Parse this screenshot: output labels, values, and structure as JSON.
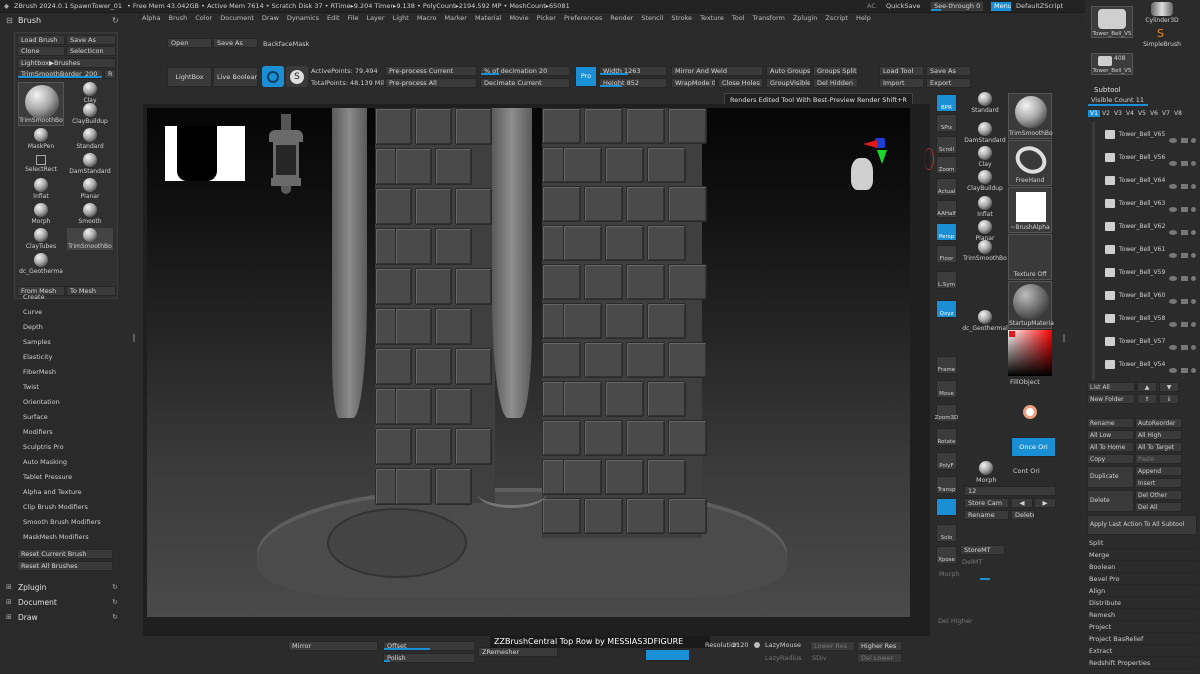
{
  "topbar": {
    "app_title": "ZBrush 2024.0.1",
    "doc_name": "SpawnTower_01",
    "stats": "• Free Mem 43.042GB • Active Mem 7614 • Scratch Disk 37 • RTime▸9.204 Timer▸9.138 • PolyCount▸2194.592 MP • MeshCount▸65081",
    "ac": "AC",
    "quicksave": "QuickSave",
    "seethrough": "See-through",
    "seethrough_val": "0",
    "menus": "Menus",
    "default_zscript": "DefaultZScript"
  },
  "menubar": [
    "Alpha",
    "Brush",
    "Color",
    "Document",
    "Draw",
    "Dynamics",
    "Edit",
    "File",
    "Layer",
    "Light",
    "Macro",
    "Marker",
    "Material",
    "Movie",
    "Picker",
    "Preferences",
    "Render",
    "Stencil",
    "Stroke",
    "Texture",
    "Tool",
    "Transform",
    "Zplugin",
    "Zscript",
    "Help"
  ],
  "brush_panel": {
    "title": "Brush",
    "load_brush": "Load Brush",
    "save_as": "Save As",
    "clone": "Clone",
    "select_icon": "SelectIcon",
    "lightbox_brushes": "Lightbox▶Brushes",
    "current_brush_slider": "TrimSmoothBorder_200",
    "r_btn": "R",
    "current_brush_label": "TrimSmoothBo",
    "brushes": [
      "Clay",
      "ClayBuildup",
      "MaskPen",
      "Standard",
      "SelectRect",
      "DamStandard",
      "Inflat",
      "Planar",
      "Morph",
      "Smooth",
      "ClayTubes",
      "TrimSmoothBo",
      "dc_Geotherma"
    ],
    "from_mesh": "From Mesh",
    "to_mesh": "To Mesh",
    "submenus": [
      "Create",
      "Curve",
      "Depth",
      "Samples",
      "Elasticity",
      "FiberMesh",
      "Twist",
      "Orientation",
      "Surface",
      "Modifiers",
      "Sculptris Pro",
      "Auto Masking",
      "Tablet Pressure",
      "Alpha and Texture",
      "Clip Brush Modifiers",
      "Smooth Brush Modifiers",
      "MaskMesh Modifiers"
    ],
    "reset_current": "Reset Current Brush",
    "reset_all": "Reset All Brushes"
  },
  "left_bottom_menus": [
    "Zplugin",
    "Document",
    "Draw"
  ],
  "top_shelf": {
    "open": "Open",
    "save_as": "Save As",
    "backface_mask": "BackfaceMask",
    "lightbox": "LightBox",
    "live_boolean": "Live Boolean",
    "active_points": "ActivePoints: 79,494",
    "total_points": "TotalPoints: 48.139 Mil",
    "preprocess_current": "Pre-process Current",
    "preprocess_all": "Pre-process All",
    "pct_decimation": "% of decimation",
    "pct_decimation_val": "20",
    "decimate_current": "Decimate Current",
    "pro": "Pro",
    "width_lbl": "Width",
    "width_val": "1263",
    "height_lbl": "Height",
    "height_val": "852",
    "mirror_weld": "Mirror And Weld",
    "wrapmode": "WrapMode",
    "wrapmode_val": "0",
    "close_holes": "Close Holes",
    "auto_groups": "Auto Groups",
    "groups_split": "Groups Split",
    "group_visible": "GroupVisible",
    "del_hidden": "Del Hidden",
    "load_tool": "Load Tool",
    "save_as2": "Save As",
    "import": "Import",
    "export": "Export"
  },
  "tooltip": "Renders Edited Tool With Best-Preview Render  Shift+R",
  "right_shelf": {
    "bpr": "BPR",
    "spix": "SPix",
    "spix_val": "3",
    "scroll": "Scroll",
    "zoom": "Zoom",
    "actual": "Actual",
    "aahalf": "AAHalf",
    "persp": "Persp",
    "floor": "Floor",
    "lsym": "L.Sym",
    "xyz": "Qxyz",
    "frame": "Frame",
    "move": "Move",
    "zoom3d": "Zoom3D",
    "rotate": "Rotate",
    "polyf": "PolyF",
    "transp": "Transp",
    "solo": "Solo",
    "xpose": "Xpose"
  },
  "quick_brushes": {
    "items": [
      "Standard",
      "DamStandard",
      "Clay",
      "ClayBuildup",
      "Inflat",
      "Planar",
      "TrimSmoothBo",
      "dc_Geothermal"
    ],
    "big_brush": "TrimSmoothBo",
    "freehand": "FreeHand",
    "brush_alpha": "~BrushAlpha",
    "texture_off": "Texture Off",
    "startup_material": "StartupMateria",
    "fill_object": "FillObject",
    "once_ori": "Once Ori",
    "cont_ori": "Cont Ori",
    "morph": "Morph",
    "num_field": "12",
    "store_cam": "Store Cam",
    "rename": "Rename",
    "delete": "Delete",
    "store_mt": "StoreMT",
    "del_mt": "DelMT",
    "morph_slider": "Morph",
    "del_higher": "Del Higher"
  },
  "bottom_shelf": {
    "mirror": "Mirror",
    "offset": "Offset",
    "polish": "Polish",
    "zremesher": "ZRemesher",
    "resolution": "Resolution",
    "resolution_val": "2120",
    "lazy_mouse": "LazyMouse",
    "lazy_radius": "LazyRadius",
    "lower_res": "Lower Res",
    "higher_res": "Higher Res",
    "sdiv": "SDiv",
    "del_lower": "Del Lower",
    "marquee": "ZZBrushCentral Top Row by MESSIAS3DFIGURE"
  },
  "tool_thumbs": {
    "cylinder": "Cylinder3D",
    "simple_brush": "SimpleBrush",
    "tower_bell": "Tower_Bell_V54",
    "tower_bell_short": "Tower_Bell_V5",
    "count": "408"
  },
  "subtool": {
    "title": "Subtool",
    "visible_count": "Visible Count",
    "visible_count_val": "11",
    "versions": [
      "V1",
      "V2",
      "V3",
      "V4",
      "V5",
      "V6",
      "V7",
      "V8"
    ],
    "items": [
      "Tower_Bell_V65",
      "Tower_Bell_V56",
      "Tower_Bell_V64",
      "Tower_Bell_V63",
      "Tower_Bell_V62",
      "Tower_Bell_V61",
      "Tower_Bell_V59",
      "Tower_Bell_V60",
      "Tower_Bell_V58",
      "Tower_Bell_V57",
      "Tower_Bell_V54"
    ],
    "list_all": "List All",
    "new_folder": "New Folder",
    "rename": "Rename",
    "auto_reorder": "AutoReorder",
    "all_low": "All Low",
    "all_high": "All High",
    "all_to_home": "All To Home",
    "all_to_target": "All To Target",
    "copy": "Copy",
    "paste": "Paste",
    "append": "Append",
    "duplicate": "Duplicate",
    "insert": "Insert",
    "delete": "Delete",
    "del_other": "Del Other",
    "del_all": "Del All",
    "apply_last": "Apply Last Action To All Subtool",
    "subpanels": [
      "Split",
      "Merge",
      "Boolean",
      "Bevel Pro",
      "Align",
      "Distribute",
      "Remesh",
      "Project",
      "Project BasRelief",
      "Extract",
      "Redshift Properties"
    ]
  },
  "colors": {
    "accent": "#1a8fd6",
    "panel": "#2b2b2b",
    "button": "#3a3a3a"
  }
}
